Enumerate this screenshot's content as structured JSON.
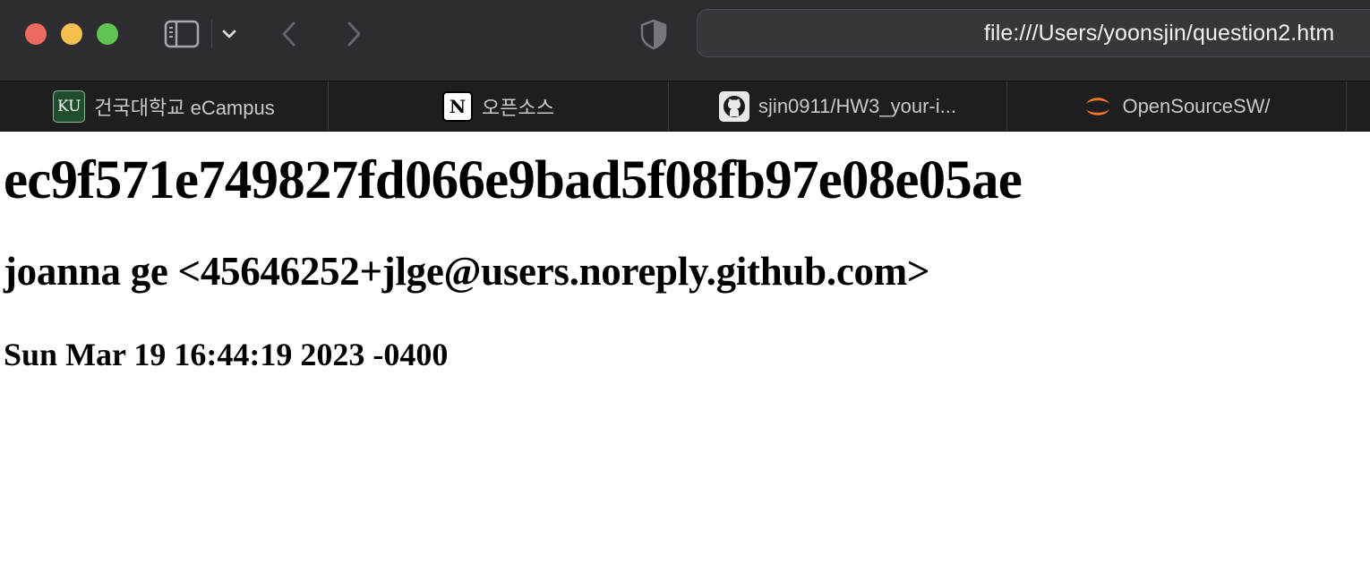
{
  "browser": {
    "address_url": "file:///Users/yoonsjin/question2.htm"
  },
  "bookmarks": [
    {
      "label": "건국대학교 eCampus",
      "icon": "ku-icon",
      "icon_text": "KU"
    },
    {
      "label": "오픈소스",
      "icon": "notion-icon",
      "icon_text": "N"
    },
    {
      "label": "sjin0911/HW3_your-i...",
      "icon": "github-icon"
    },
    {
      "label": "OpenSourceSW/",
      "icon": "jupyter-icon"
    }
  ],
  "page": {
    "commit_hash": "ec9f571e749827fd066e9bad5f08fb97e08e05ae",
    "author": "joanna ge <45646252+jlge@users.noreply.github.com>",
    "date": "Sun Mar 19 16:44:19 2023 -0400"
  },
  "colors": {
    "close": "#ec6a5e",
    "minimize": "#f4bf4f",
    "maximize": "#61c554",
    "toolbar_bg": "#2d2c31",
    "bookmarks_bg": "#1e1e21"
  }
}
